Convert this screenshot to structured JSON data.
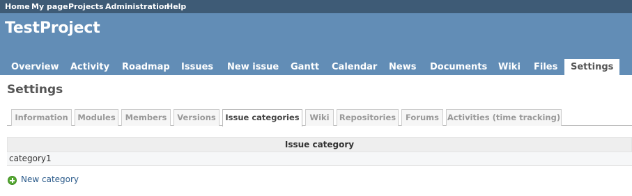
{
  "top_menu": [
    "Home",
    "My page",
    "Projects",
    "Administration",
    "Help"
  ],
  "header": {
    "project_title": "TestProject"
  },
  "main_menu": [
    "Overview",
    "Activity",
    "Roadmap",
    "Issues",
    "New issue",
    "Gantt",
    "Calendar",
    "News",
    "Documents",
    "Wiki",
    "Files",
    "Settings"
  ],
  "main_menu_selected": "Settings",
  "page": {
    "title": "Settings"
  },
  "tabs": [
    "Information",
    "Modules",
    "Members",
    "Versions",
    "Issue categories",
    "Wiki",
    "Repositories",
    "Forums",
    "Activities (time tracking)"
  ],
  "tabs_selected": "Issue categories",
  "table": {
    "header": "Issue category",
    "rows": [
      "category1"
    ]
  },
  "actions": {
    "new_category": "New category"
  },
  "colors": {
    "top_menu_bg": "#3e5b76",
    "header_bg": "#628db6",
    "link": "#2a5a8a",
    "add_icon": "#55a832"
  },
  "icons": {
    "new_category": "add-icon"
  }
}
